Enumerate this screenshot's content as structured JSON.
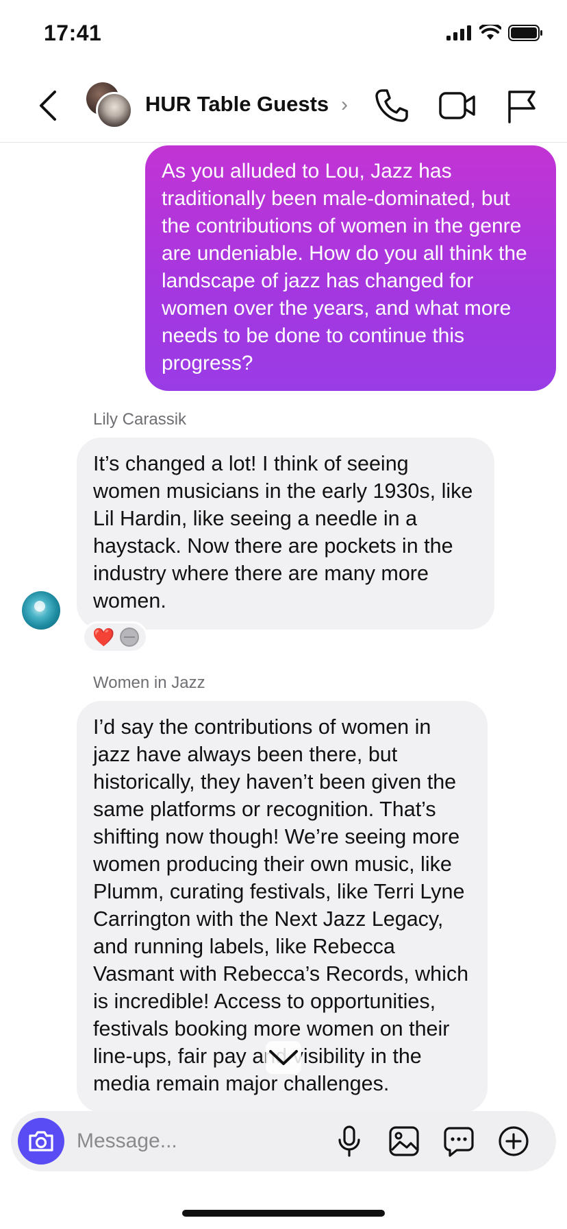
{
  "status_bar": {
    "time": "17:41",
    "icons": [
      "cellular-signal-icon",
      "wifi-icon",
      "battery-icon"
    ]
  },
  "header": {
    "title": "HUR Table Guests",
    "chevron": "›",
    "actions": [
      "phone-icon",
      "video-camera-icon",
      "flag-icon"
    ]
  },
  "messages": [
    {
      "direction": "sent",
      "text": "As you alluded to Lou, Jazz has traditionally been male-dominated, but the contributions of women in the genre are undeniable. How do you all think the landscape of jazz has changed for women over the years, and what more needs to be done to continue this progress?"
    },
    {
      "direction": "received",
      "sender": "Lily Carassik",
      "text": "It’s changed a lot! I think of seeing women musicians in the early 1930s, like Lil Hardin, like seeing a needle in a haystack. Now there are pockets in the industry where there are many more women.",
      "reactions": [
        "❤️",
        "gray-reaction"
      ]
    },
    {
      "direction": "received",
      "sender": "Women in Jazz",
      "text": "I’d say the contributions of women in jazz have always been there, but historically, they haven’t been given the same platforms or recognition. That’s shifting now though! We’re seeing more women producing their own music, like Plumm, curating festivals, like Terri Lyne Carrington with the Next Jazz Legacy, and running labels, like Rebecca Vasmant with Rebecca’s Records, which is incredible! Access to opportunities, festivals booking more women on their line-ups, fair pay and visibility in the media remain major challenges."
    }
  ],
  "composer": {
    "placeholder": "Message...",
    "icons": [
      "camera-icon",
      "microphone-icon",
      "image-icon",
      "sticker-icon",
      "plus-icon"
    ]
  },
  "colors": {
    "sent_bubble_top": "#c234d4",
    "sent_bubble_bottom": "#9a3ce6",
    "received_bubble": "#f1f1f3",
    "camera_button": "#5a4cf5"
  }
}
